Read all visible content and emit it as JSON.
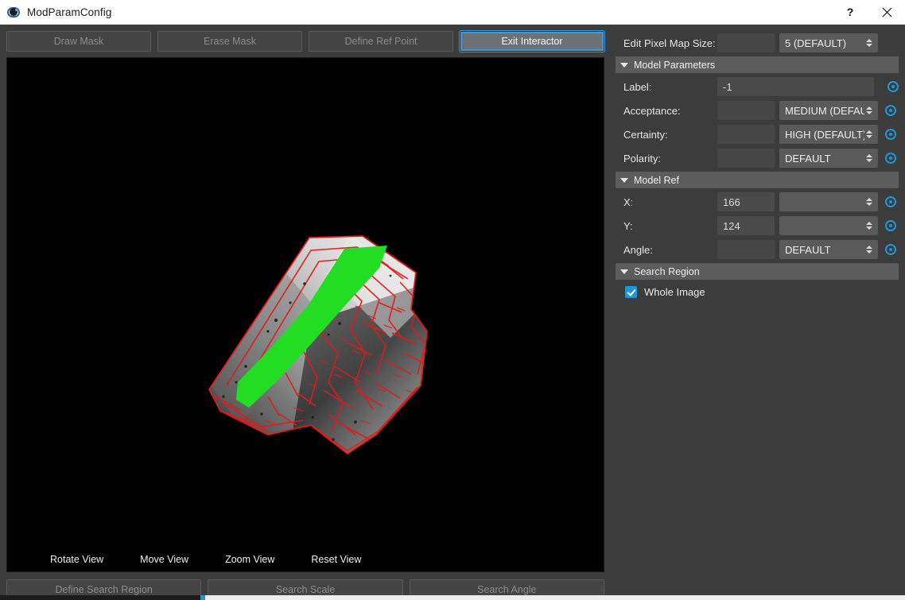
{
  "window": {
    "title": "ModParamConfig",
    "icon": "eye-icon",
    "help_label": "?",
    "close_label": "✕"
  },
  "toolbar_top": {
    "buttons": [
      {
        "label": "Draw Mask",
        "name": "draw-mask-button",
        "state": "disabled"
      },
      {
        "label": "Erase Mask",
        "name": "erase-mask-button",
        "state": "disabled"
      },
      {
        "label": "Define Ref Point",
        "name": "define-ref-point-button",
        "state": "disabled"
      },
      {
        "label": "Exit Interactor",
        "name": "exit-interactor-button",
        "state": "active"
      }
    ]
  },
  "canvas": {
    "background": "#000000",
    "mask_color": "#22dd22",
    "edge_color": "#e01b1b",
    "view_controls": [
      {
        "label": "Rotate View",
        "name": "rotate-view-control"
      },
      {
        "label": "Move View",
        "name": "move-view-control"
      },
      {
        "label": "Zoom View",
        "name": "zoom-view-control"
      },
      {
        "label": "Reset View",
        "name": "reset-view-control"
      }
    ]
  },
  "toolbar_bottom": {
    "buttons": [
      {
        "label": "Define Search Region",
        "name": "define-search-region-button",
        "state": "disabled"
      },
      {
        "label": "Search Scale",
        "name": "search-scale-button",
        "state": "disabled"
      },
      {
        "label": "Search Angle",
        "name": "search-angle-button",
        "state": "disabled"
      }
    ]
  },
  "panel": {
    "pixel_map": {
      "label": "Edit Pixel Map Size:",
      "text_value": "",
      "combo_value": "5 (DEFAULT)"
    },
    "model_parameters": {
      "section_title": "Model Parameters",
      "expanded": true,
      "rows": [
        {
          "label": "Label:",
          "text_value": "-1",
          "combo_value": null,
          "wide": true
        },
        {
          "label": "Acceptance:",
          "text_value": "",
          "combo_value": "MEDIUM (DEFAULT)",
          "wide": false
        },
        {
          "label": "Certainty:",
          "text_value": "",
          "combo_value": "HIGH (DEFAULT)",
          "wide": false
        },
        {
          "label": "Polarity:",
          "text_value": "",
          "combo_value": "DEFAULT",
          "wide": false
        }
      ]
    },
    "model_ref": {
      "section_title": "Model Ref",
      "expanded": true,
      "rows": [
        {
          "label": "X:",
          "text_value": "166",
          "combo_value": "",
          "wide": false
        },
        {
          "label": "Y:",
          "text_value": "124",
          "combo_value": "",
          "wide": false
        },
        {
          "label": "Angle:",
          "text_value": "",
          "combo_value": "DEFAULT",
          "wide": false
        }
      ]
    },
    "search_region": {
      "section_title": "Search Region",
      "expanded": true,
      "checkbox": {
        "label": "Whole Image",
        "checked": true
      }
    }
  },
  "colors": {
    "window_bg": "#3c3c3c",
    "titlebar_bg": "#ffffff",
    "section_bg": "#5c5c5c",
    "accent": "#2196d6",
    "focus_ring": "#3a9ad9",
    "field_bg": "#4a4a4a",
    "combo_bg": "#5a5a5a",
    "button_bg": "#444444",
    "button_text_disabled": "#8c8c8c"
  }
}
